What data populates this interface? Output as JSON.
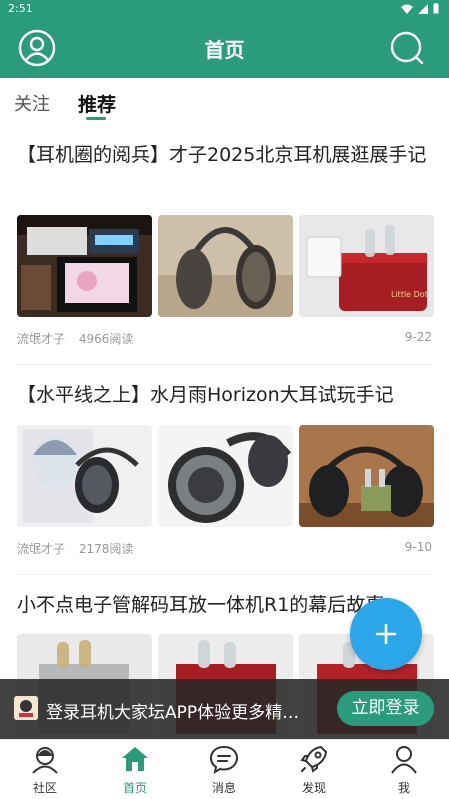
{
  "status_bar": {
    "time": "2:51"
  },
  "header": {
    "title": "首页"
  },
  "tabs": [
    {
      "label": "关注"
    },
    {
      "label": "推荐"
    }
  ],
  "posts": [
    {
      "title": "【耳机圈的阅兵】才子2025北京耳机展逛展手记",
      "author": "流氓才子",
      "reads": "4966阅读",
      "date": "9-22"
    },
    {
      "title": "【水平线之上】水月雨Horizon大耳试玩手记",
      "author": "流氓才子",
      "reads": "2178阅读",
      "date": "9-10"
    },
    {
      "title": "小不点电子管解码耳放一体机R1的幕后故事"
    }
  ],
  "banner": {
    "message": "登录耳机大家坛APP体验更多精…",
    "cta": "立即登录"
  },
  "bottom_nav": [
    {
      "label": "社区",
      "icon": "community-icon"
    },
    {
      "label": "首页",
      "icon": "home-icon"
    },
    {
      "label": "消息",
      "icon": "message-icon"
    },
    {
      "label": "发现",
      "icon": "rocket-icon"
    },
    {
      "label": "我",
      "icon": "person-icon"
    }
  ],
  "colors": {
    "primary": "#2a9c7c",
    "fab": "#2ba6e8"
  }
}
